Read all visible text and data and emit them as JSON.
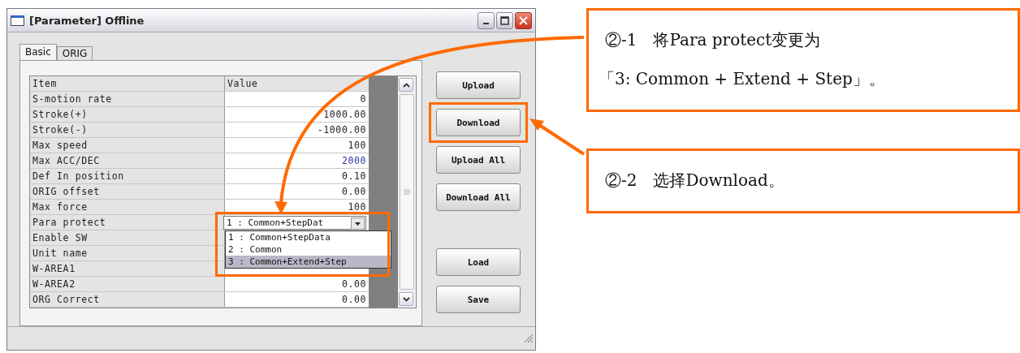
{
  "window": {
    "title": "[Parameter] Offline"
  },
  "tabs": [
    {
      "label": "Basic",
      "selected": true
    },
    {
      "label": "ORIG",
      "selected": false
    }
  ],
  "table": {
    "columns": [
      "Item",
      "Value"
    ],
    "rows": [
      {
        "kind": "text",
        "item": "S-motion rate",
        "value": "0",
        "modified": false
      },
      {
        "kind": "text",
        "item": "Stroke(+)",
        "value": "1000.00",
        "modified": false
      },
      {
        "kind": "text",
        "item": "Stroke(-)",
        "value": "-1000.00",
        "modified": false
      },
      {
        "kind": "text",
        "item": "Max speed",
        "value": "100",
        "modified": false
      },
      {
        "kind": "text",
        "item": "Max ACC/DEC",
        "value": "2000",
        "modified": true
      },
      {
        "kind": "text",
        "item": "Def In position",
        "value": "0.10",
        "modified": false
      },
      {
        "kind": "text",
        "item": "ORIG offset",
        "value": "0.00",
        "modified": false
      },
      {
        "kind": "text",
        "item": "Max force",
        "value": "100",
        "modified": false
      },
      {
        "kind": "dropdown",
        "item": "Para protect",
        "value": "1 : Common+StepDat",
        "highlighted": true,
        "options": [
          {
            "label": "1 : Common+StepData",
            "selected": false
          },
          {
            "label": "2 : Common",
            "selected": false
          },
          {
            "label": "3 : Common+Extend+Step",
            "selected": true
          }
        ]
      },
      {
        "kind": "text",
        "item": "Enable SW"
      },
      {
        "kind": "text",
        "item": "Unit name"
      },
      {
        "kind": "text",
        "item": "W-AREA1"
      },
      {
        "kind": "text",
        "item": "W-AREA2",
        "value": "0.00",
        "modified": false
      },
      {
        "kind": "text",
        "item": "ORG Correct",
        "value": "0.00",
        "modified": false
      }
    ]
  },
  "button_groups": [
    [
      {
        "label": "Upload",
        "highlighted": false
      },
      {
        "label": "Download",
        "highlighted": true
      },
      {
        "label": "Upload All",
        "highlighted": false
      },
      {
        "label": "Download All",
        "highlighted": false
      }
    ],
    [
      {
        "label": "Load",
        "highlighted": false
      },
      {
        "label": "Save",
        "highlighted": false
      }
    ]
  ],
  "callouts": [
    {
      "lines": [
        "②-1　将Para protect变更为",
        "「3: Common + Extend + Step」。"
      ]
    },
    {
      "lines": [
        "②-2　选择Download。"
      ]
    }
  ]
}
